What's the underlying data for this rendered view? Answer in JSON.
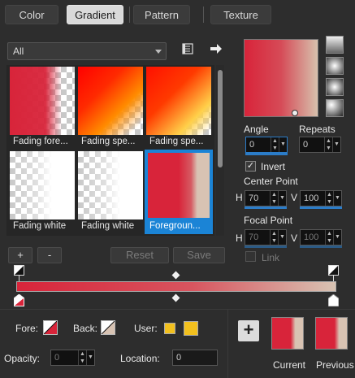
{
  "tabs": [
    "Color",
    "Gradient",
    "Pattern",
    "Texture"
  ],
  "active_tab": "Gradient",
  "filter": {
    "value": "All"
  },
  "gallery": [
    {
      "label": "Fading fore...",
      "style": "fore"
    },
    {
      "label": "Fading spe...",
      "style": "spe1"
    },
    {
      "label": "Fading spe...",
      "style": "spe2"
    },
    {
      "label": "Fading white",
      "style": "white"
    },
    {
      "label": "Fading white",
      "style": "white"
    },
    {
      "label": "Foregroun...",
      "style": "fg",
      "selected": true
    }
  ],
  "buttons": {
    "add": "+",
    "remove": "-",
    "reset": "Reset",
    "save": "Save",
    "add_user": "+"
  },
  "angle": {
    "label": "Angle",
    "value": "0"
  },
  "repeats": {
    "label": "Repeats",
    "value": "0"
  },
  "invert": {
    "label": "Invert",
    "checked": true
  },
  "center_point": {
    "label": "Center Point",
    "h_label": "H",
    "h": "70",
    "v_label": "V",
    "v": "100"
  },
  "focal_point": {
    "label": "Focal Point",
    "h_label": "H",
    "h": "70",
    "v_label": "V",
    "v": "100"
  },
  "link": {
    "label": "Link"
  },
  "colors": {
    "fore_label": "Fore:",
    "back_label": "Back:",
    "user_label": "User:",
    "primary": "#d8243a",
    "end": "#d8c3b3",
    "user_fill": "#f2c01e",
    "accent": "#1b84d6"
  },
  "opacity": {
    "label": "Opacity:",
    "value": "0"
  },
  "location": {
    "label": "Location:",
    "value": "0"
  },
  "current_label": "Current",
  "previous_label": "Previous"
}
